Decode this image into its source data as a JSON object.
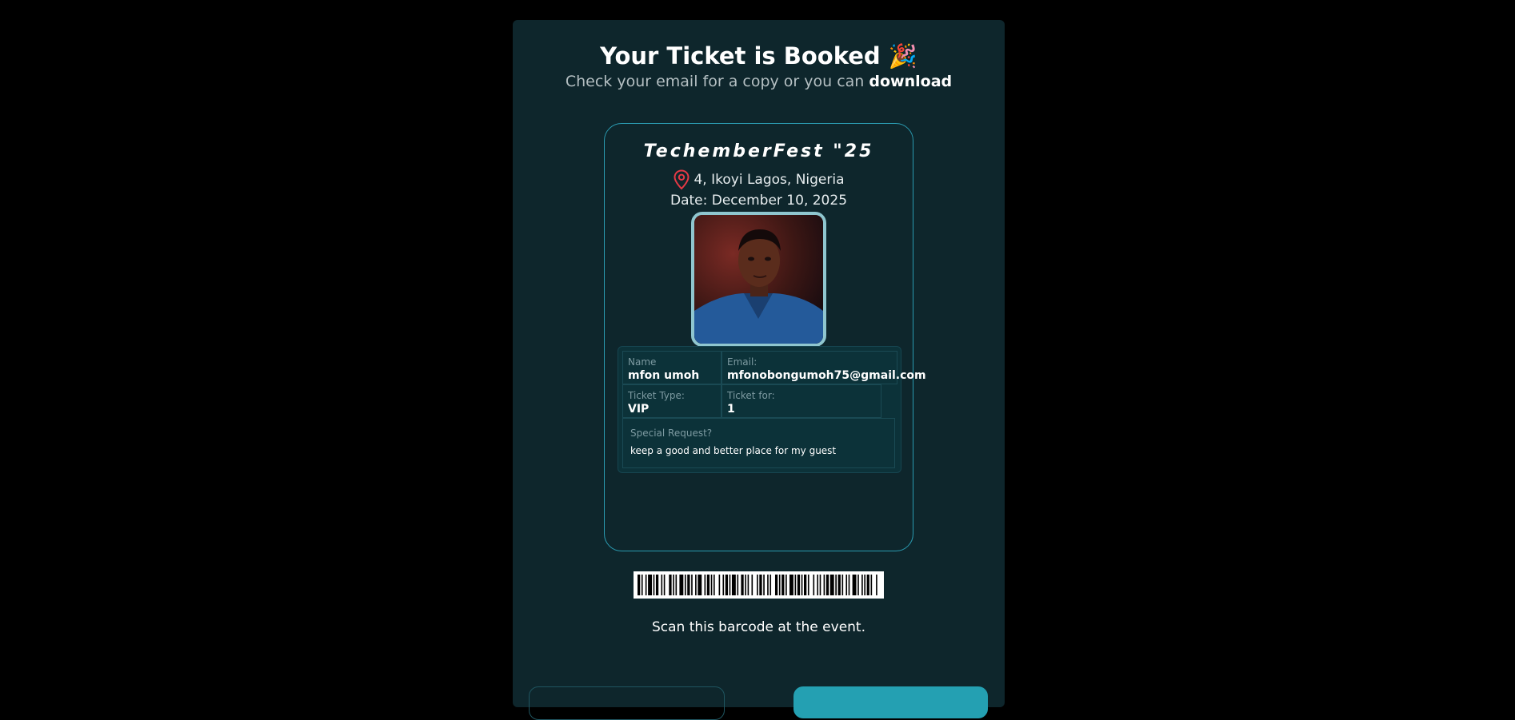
{
  "page": {
    "title_text": "Your Ticket is Booked",
    "title_emoji": "🎉",
    "subtitle_prefix": "Check your email for a copy or you can",
    "download_link": "download"
  },
  "ticket": {
    "event_name": "TechemberFest \"25",
    "location": "4, Ikoyi Lagos, Nigeria",
    "date": "Date: December 10, 2025",
    "avatar_icon": "attendee-photo",
    "fields": {
      "name_label": "Name",
      "name_value": "mfon umoh",
      "email_label": "Email:",
      "email_value": "mfonobongumoh75@gmail.com",
      "type_label": "Ticket Type:",
      "type_value": "VIP",
      "for_label": "Ticket for:",
      "for_value": "1",
      "request_label": "Special Request?",
      "request_value": "keep a good and better place for my guest"
    }
  },
  "barcode": {
    "caption": "Scan this barcode at the event.",
    "bars": [
      2,
      1,
      1,
      2,
      1,
      1,
      3,
      1,
      1,
      1,
      2,
      2,
      1,
      1,
      1,
      3,
      2,
      1,
      1,
      1,
      1,
      2,
      3,
      1,
      1,
      1,
      2,
      1,
      1,
      2,
      1,
      1,
      3,
      2,
      1,
      1,
      2,
      1,
      1,
      1,
      1,
      3,
      1,
      2,
      1,
      1,
      2,
      1,
      1,
      1,
      3,
      1,
      1,
      2,
      2,
      1,
      1,
      1,
      1,
      2,
      1,
      3,
      1,
      1,
      2,
      1,
      1,
      2,
      1,
      1,
      1,
      3,
      2,
      1,
      1,
      1,
      2,
      1,
      1,
      2,
      3,
      1,
      1,
      1,
      2,
      1,
      1,
      1,
      2,
      1,
      1,
      3,
      1,
      2,
      1,
      1,
      1,
      2,
      1,
      1,
      2,
      1,
      3,
      1,
      1,
      1,
      2,
      1,
      1,
      2,
      1,
      1,
      1,
      2,
      3,
      1,
      1,
      2,
      1,
      1,
      1,
      1,
      2,
      1,
      1,
      3,
      1,
      2
    ]
  },
  "colors": {
    "accent": "#24a0b2",
    "panel_bg": "#0e262c",
    "card_border": "#2a9ab0",
    "pin_red": "#e53945"
  }
}
